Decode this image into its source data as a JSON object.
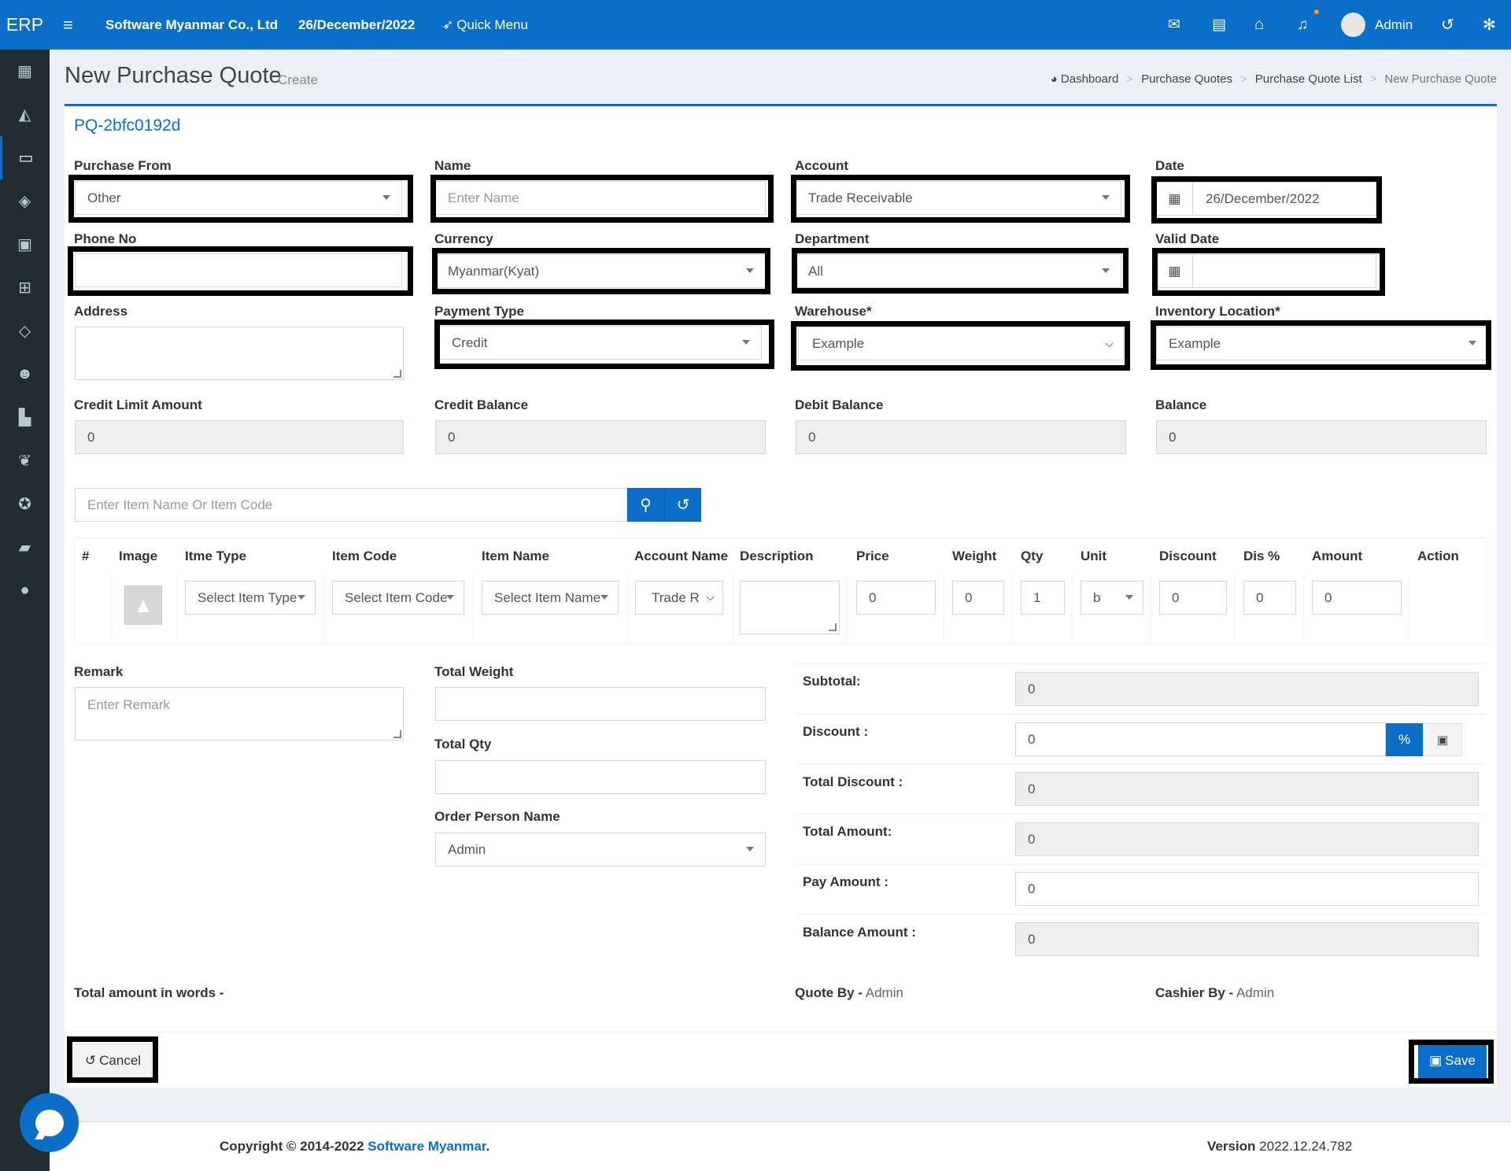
{
  "topbar": {
    "logo": "ERP",
    "company": "Software Myanmar Co., Ltd",
    "date": "26/December/2022",
    "quick_menu": "Quick Menu",
    "user": "Admin"
  },
  "header": {
    "title": "New Purchase Quote",
    "subtitle": "Create",
    "breadcrumb": [
      "Dashboard",
      "Purchase Quotes",
      "Purchase Quote List",
      "New Purchase Quote"
    ]
  },
  "form": {
    "doc_no": "PQ-2bfc0192d",
    "purchase_from": {
      "label": "Purchase From",
      "value": "Other"
    },
    "name": {
      "label": "Name",
      "placeholder": "Enter Name"
    },
    "account": {
      "label": "Account",
      "value": "Trade Receivable"
    },
    "date": {
      "label": "Date",
      "value": "26/December/2022"
    },
    "phone": {
      "label": "Phone No",
      "value": ""
    },
    "currency": {
      "label": "Currency",
      "value": "Myanmar(Kyat)"
    },
    "department": {
      "label": "Department",
      "value": "All"
    },
    "valid_date": {
      "label": "Valid Date",
      "value": ""
    },
    "address": {
      "label": "Address",
      "value": ""
    },
    "payment_type": {
      "label": "Payment Type",
      "value": "Credit"
    },
    "warehouse": {
      "label": "Warehouse*",
      "value": "Example"
    },
    "inventory_location": {
      "label": "Inventory Location*",
      "value": "Example"
    },
    "credit_limit": {
      "label": "Credit Limit Amount",
      "value": "0"
    },
    "credit_balance": {
      "label": "Credit Balance",
      "value": "0"
    },
    "debit_balance": {
      "label": "Debit Balance",
      "value": "0"
    },
    "balance": {
      "label": "Balance",
      "value": "0"
    }
  },
  "search": {
    "placeholder": "Enter Item Name Or Item Code"
  },
  "table": {
    "headers": [
      "#",
      "Image",
      "Itme Type",
      "Item Code",
      "Item Name",
      "Account Name",
      "Description",
      "Price",
      "Weight",
      "Qty",
      "Unit",
      "Discount",
      "Dis %",
      "Amount",
      "Action"
    ],
    "row": {
      "item_type": "Select Item Type",
      "item_code": "Select Item Code",
      "item_name": "Select Item Name",
      "account_name": "Trade R",
      "price": "0",
      "weight": "0",
      "qty": "1",
      "unit": "b",
      "discount": "0",
      "dis_pct": "0",
      "amount": "0"
    }
  },
  "bottom": {
    "remark": {
      "label": "Remark",
      "placeholder": "Enter Remark"
    },
    "total_weight": {
      "label": "Total Weight",
      "value": ""
    },
    "total_qty": {
      "label": "Total Qty",
      "value": ""
    },
    "order_person": {
      "label": "Order Person Name",
      "value": "Admin"
    }
  },
  "totals": {
    "subtotal": {
      "label": "Subtotal:",
      "value": "0"
    },
    "discount": {
      "label": "Discount :",
      "value": "0",
      "pct_label": "%"
    },
    "total_discount": {
      "label": "Total Discount :",
      "value": "0"
    },
    "total_amount": {
      "label": "Total Amount:",
      "value": "0"
    },
    "pay_amount": {
      "label": "Pay Amount :",
      "value": "0"
    },
    "balance_amount": {
      "label": "Balance Amount :",
      "value": "0"
    }
  },
  "summary": {
    "words_label": "Total amount in words -",
    "quote_by_label": "Quote By -",
    "quote_by_value": "Admin",
    "cashier_by_label": "Cashier By -",
    "cashier_by_value": "Admin"
  },
  "actions": {
    "cancel": "Cancel",
    "save": "Save"
  },
  "footer": {
    "copyright": "Copyright © 2014-2022",
    "company_link": "Software Myanmar",
    "period": ".",
    "version_label": "Version",
    "version_value": "2022.12.24.782"
  },
  "colors": {
    "primary": "#0b6fc9",
    "sidebar": "#222d32"
  }
}
